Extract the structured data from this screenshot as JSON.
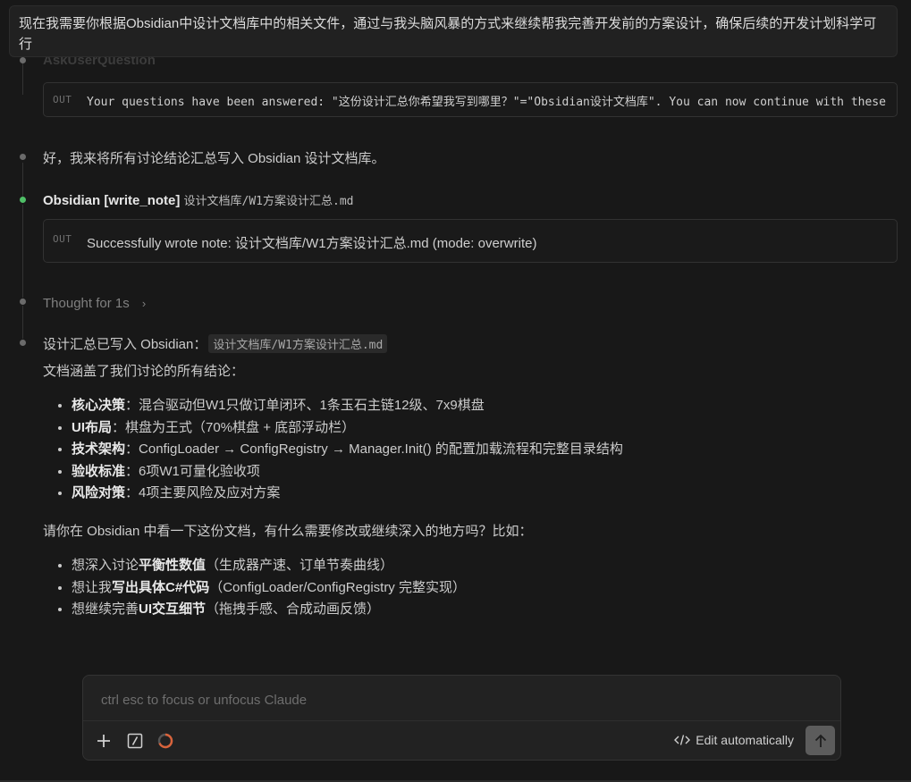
{
  "user_message": "现在我需要你根据Obsidian中设计文档库中的相关文件，通过与我头脑风暴的方式来继续帮我完善开发前的方案设计，确保后续的开发计划科学可行",
  "ask_user_question": {
    "title": "AskUserQuestion",
    "out_label": "OUT",
    "out_text": "Your questions have been answered: \"这份设计汇总你希望我写到哪里？\"=\"Obsidian设计文档库\". You can now continue with these"
  },
  "step_write_intro": "好，我来将所有讨论结论汇总写入 Obsidian 设计文档库。",
  "tool_call": {
    "name": "Obsidian [write_note]",
    "path": "设计文档库/W1方案设计汇总.md",
    "out_label": "OUT",
    "out_text": "Successfully wrote note: 设计文档库/W1方案设计汇总.md (mode: overwrite)"
  },
  "thought": {
    "label": "Thought for 1s",
    "chevron": "›"
  },
  "summary": {
    "line1_prefix": "设计汇总已写入 Obsidian：",
    "line1_code": "设计文档库/W1方案设计汇总.md",
    "line2": "文档涵盖了我们讨论的所有结论：",
    "bullets": [
      {
        "bold": "核心决策",
        "rest": "：混合驱动但W1只做订单闭环、1条玉石主链12级、7x9棋盘"
      },
      {
        "bold": "UI布局",
        "rest": "：棋盘为王式（70%棋盘 + 底部浮动栏）"
      },
      {
        "bold": "技术架构",
        "rest": "：ConfigLoader → ConfigRegistry → Manager.Init() 的配置加载流程和完整目录结构"
      },
      {
        "bold": "验收标准",
        "rest": "：6项W1可量化验收项"
      },
      {
        "bold": "风险对策",
        "rest": "：4项主要风险及应对方案"
      }
    ],
    "question": "请你在 Obsidian 中看一下这份文档，有什么需要修改或继续深入的地方吗？比如：",
    "options": [
      {
        "pre": "想深入讨论",
        "bold": "平衡性数值",
        "post": "（生成器产速、订单节奏曲线）"
      },
      {
        "pre": "想让我",
        "bold": "写出具体C#代码",
        "post": "（ConfigLoader/ConfigRegistry 完整实现）"
      },
      {
        "pre": "想继续完善",
        "bold": "UI交互细节",
        "post": "（拖拽手感、合成动画反馈）"
      }
    ]
  },
  "composer": {
    "placeholder": "ctrl esc to focus or unfocus Claude",
    "edit_label": "Edit automatically",
    "icons": [
      "plus-icon",
      "slash-command-icon",
      "context-usage-icon",
      "code-icon",
      "arrow-up-icon"
    ]
  },
  "colors": {
    "background": "#181818",
    "success_dot": "#4fbf67",
    "progress_ring": "#d9633b",
    "send_button": "#5c5c5c"
  }
}
